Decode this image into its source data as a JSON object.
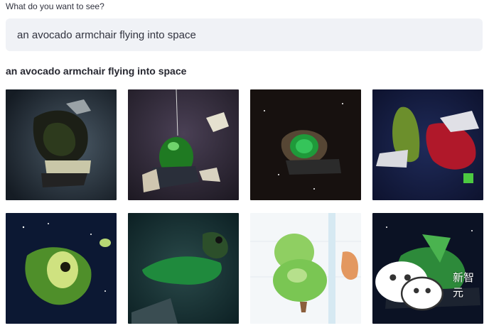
{
  "prompt": {
    "label": "What do you want to see?",
    "value": "an avocado armchair flying into space"
  },
  "results": {
    "title": "an avocado armchair flying into space",
    "images": [
      {
        "name": "generated-image-1"
      },
      {
        "name": "generated-image-2"
      },
      {
        "name": "generated-image-3"
      },
      {
        "name": "generated-image-4"
      },
      {
        "name": "generated-image-5"
      },
      {
        "name": "generated-image-6"
      },
      {
        "name": "generated-image-7"
      },
      {
        "name": "generated-image-8"
      }
    ]
  },
  "watermark": {
    "text": "新智元",
    "icon": "wechat-logo-icon"
  },
  "colors": {
    "input_background": "#f0f2f6",
    "text": "#31333f",
    "avocado_green": "#3fae3a"
  }
}
